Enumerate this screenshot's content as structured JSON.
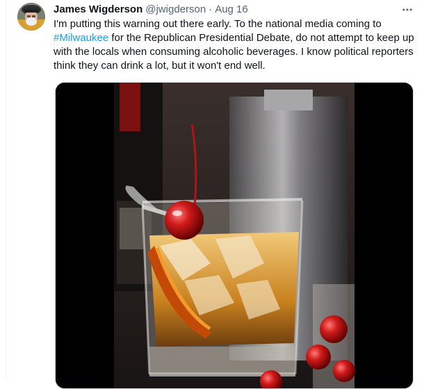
{
  "tweet": {
    "author_name": "James Wigderson",
    "author_handle": "@jwigderson",
    "separator": "·",
    "date": "Aug 16",
    "text_before": "I'm putting this warning out there early. To the national media coming to ",
    "hashtag": "#Milwaukee",
    "text_after": " for the Republican Presidential Debate, do not attempt to keep up with the locals when consuming alcoholic beverages. I know political reporters think they can drink a lot, but it won't end well."
  },
  "icons": {
    "more": "more-horizontal-icon",
    "avatar": "user-avatar-photo"
  },
  "colors": {
    "link": "#1d9bf0",
    "secondary_text": "#536471",
    "primary_text": "#0f1419"
  }
}
